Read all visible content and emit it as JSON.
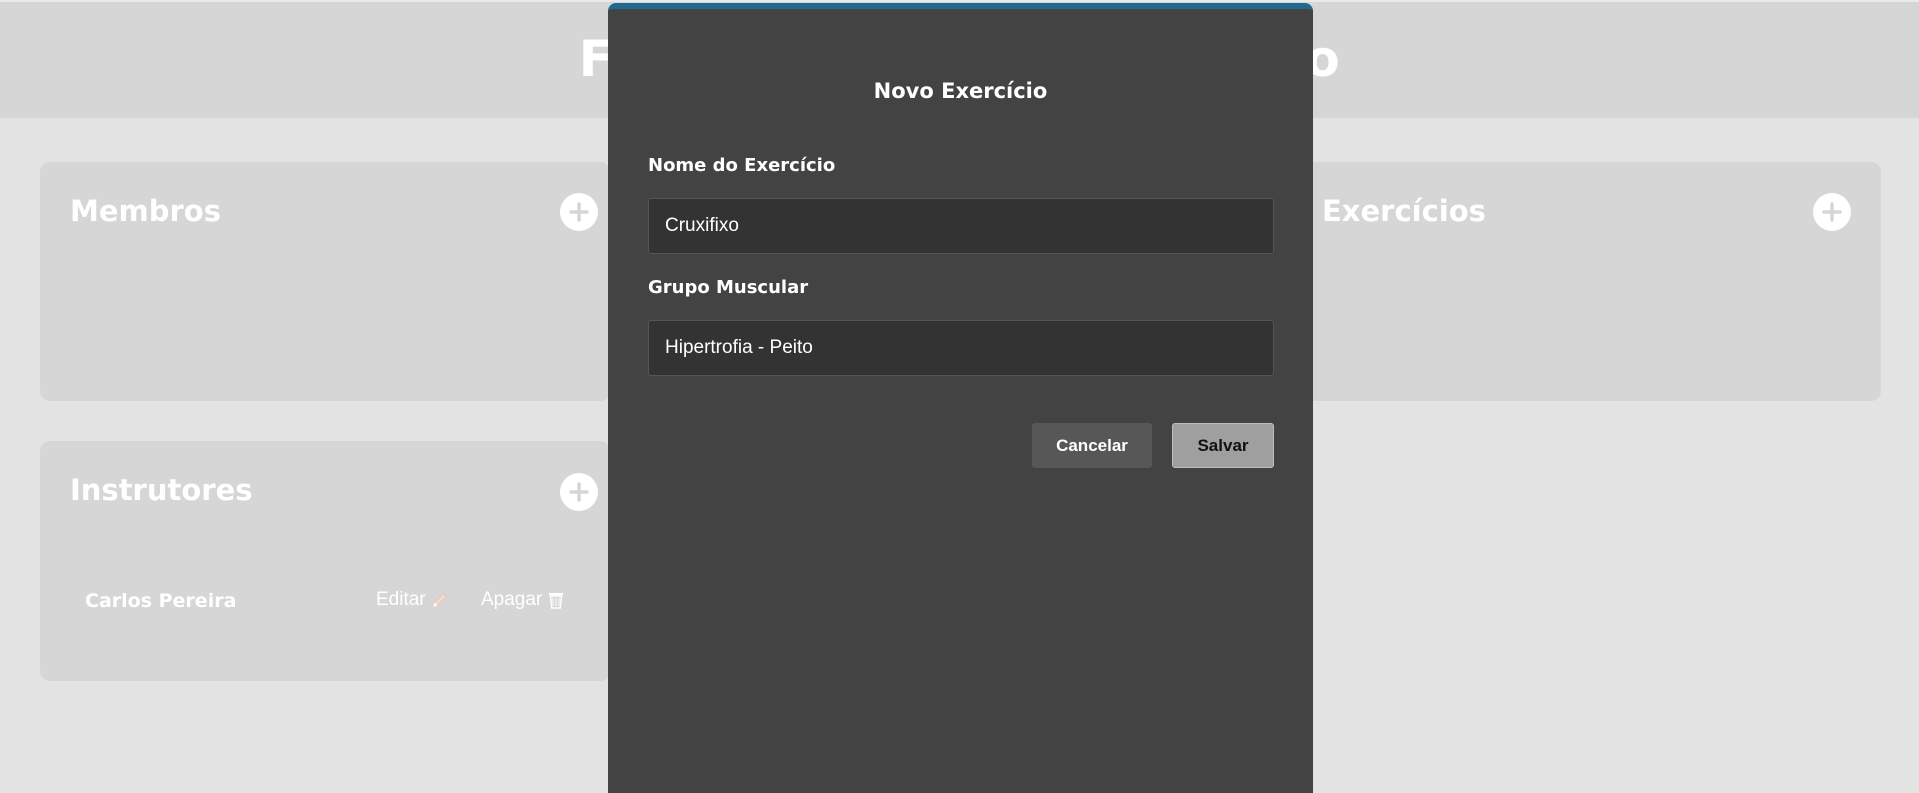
{
  "header": {
    "title": "Fit Manager - Treinamento"
  },
  "panels": {
    "membros": {
      "title": "Membros"
    },
    "exercicios": {
      "title": "Exercícios"
    },
    "instrutores": {
      "title": "Instrutores",
      "rows": [
        {
          "name": "Carlos Pereira",
          "edit_label": "Editar",
          "delete_label": "Apagar"
        }
      ]
    }
  },
  "icons": {
    "add": "plus-circle-icon",
    "edit": "pencil-icon",
    "delete": "trash-icon"
  },
  "modal": {
    "title": "Novo Exercício",
    "name_label": "Nome do Exercício",
    "name_value": "Cruxifixo",
    "group_label": "Grupo Muscular",
    "group_value": "Hipertrofia - Peito",
    "cancel_label": "Cancelar",
    "save_label": "Salvar"
  },
  "colors": {
    "modal_bg": "#434343",
    "modal_accent": "#1f6a8e",
    "panel_bg": "#d6d6d6",
    "page_bg": "#e3e3e3"
  }
}
